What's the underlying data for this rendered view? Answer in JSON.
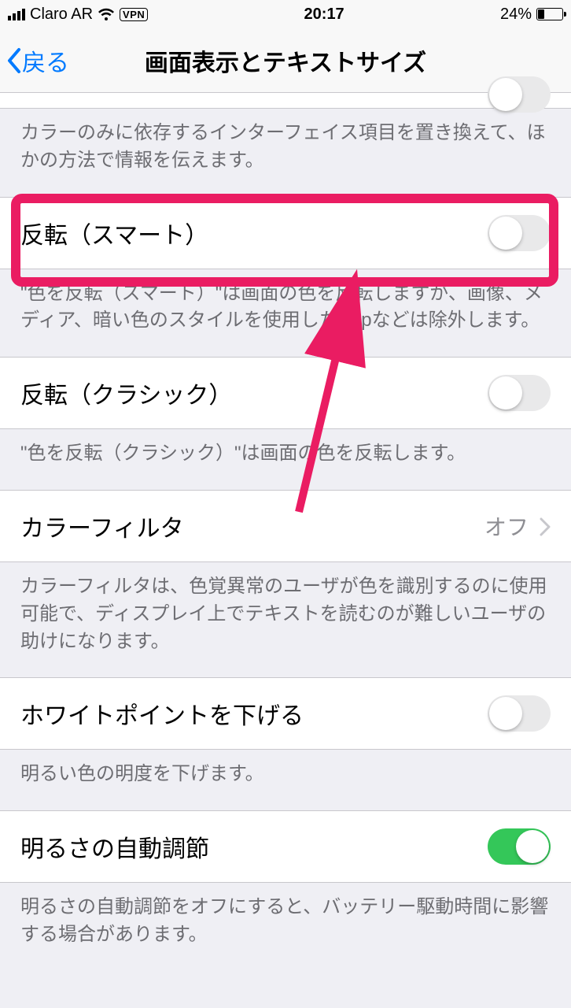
{
  "status_bar": {
    "carrier": "Claro AR",
    "vpn_label": "VPN",
    "time": "20:17",
    "battery_pct": "24%"
  },
  "nav": {
    "back_label": "戻る",
    "title": "画面表示とテキストサイズ"
  },
  "section_top": {
    "footer": "カラーのみに依存するインターフェイス項目を置き換えて、ほかの方法で情報を伝えます。"
  },
  "smart_invert": {
    "label": "反転（スマート）",
    "on": false,
    "footer": "\"色を反転（スマート）\"は画面の色を反転しますが、画像、メディア、暗い色のスタイルを使用したAppなどは除外します。"
  },
  "classic_invert": {
    "label": "反転（クラシック）",
    "on": false,
    "footer": "\"色を反転（クラシック）\"は画面の色を反転します。"
  },
  "color_filter": {
    "label": "カラーフィルタ",
    "value": "オフ",
    "footer": "カラーフィルタは、色覚異常のユーザが色を識別するのに使用可能で、ディスプレイ上でテキストを読むのが難しいユーザの助けになります。"
  },
  "white_point": {
    "label": "ホワイトポイントを下げる",
    "on": false,
    "footer": "明るい色の明度を下げます。"
  },
  "auto_brightness": {
    "label": "明るさの自動調節",
    "on": true,
    "footer": "明るさの自動調節をオフにすると、バッテリー駆動時間に影響する場合があります。"
  },
  "annotation": {
    "color": "#ea1c62"
  }
}
